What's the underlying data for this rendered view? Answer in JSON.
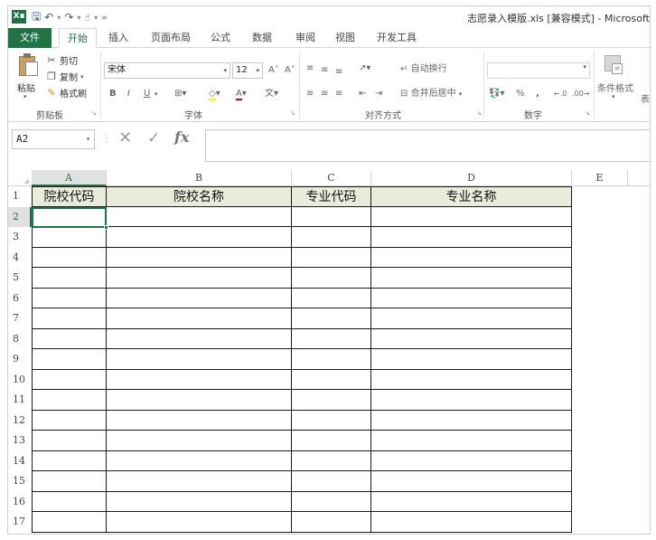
{
  "app": {
    "logo_text": "X∎",
    "title": "志愿录入模版.xls  [兼容模式] - Microsoft"
  },
  "tabs": [
    {
      "label": "文件"
    },
    {
      "label": "开始"
    },
    {
      "label": "插入"
    },
    {
      "label": "页面布局"
    },
    {
      "label": "公式"
    },
    {
      "label": "数据"
    },
    {
      "label": "审阅"
    },
    {
      "label": "视图"
    },
    {
      "label": "开发工具"
    }
  ],
  "ribbon": {
    "clipboard": {
      "paste": "粘贴",
      "cut": "剪切",
      "copy": "复制",
      "format_painter": "格式刷",
      "group_label": "剪贴板"
    },
    "font": {
      "name": "宋体",
      "size": "12",
      "bold": "B",
      "italic": "I",
      "underline": "U",
      "group_label": "字体"
    },
    "alignment": {
      "wrap_text": "自动换行",
      "merge_center": "合并后居中",
      "group_label": "对齐方式"
    },
    "number": {
      "percent": "%",
      "comma": ",",
      "group_label": "数字"
    },
    "styles": {
      "conditional_format": "条件格式",
      "table_hint": "表"
    }
  },
  "formula_bar": {
    "name_box": "A2",
    "cancel": "✕",
    "enter": "✓",
    "fx": "fx",
    "value": ""
  },
  "sheet": {
    "columns": [
      "A",
      "B",
      "C",
      "D",
      "E"
    ],
    "rows": [
      "1",
      "2",
      "3",
      "4",
      "5",
      "6",
      "7",
      "8",
      "9",
      "10",
      "11",
      "12",
      "13",
      "14",
      "15",
      "16",
      "17"
    ],
    "header_cells": [
      "院校代码",
      "院校名称",
      "专业代码",
      "专业名称"
    ],
    "selected_cell": "A2"
  },
  "colors": {
    "brand": "#217346",
    "header_fill": "#ebebdc"
  }
}
